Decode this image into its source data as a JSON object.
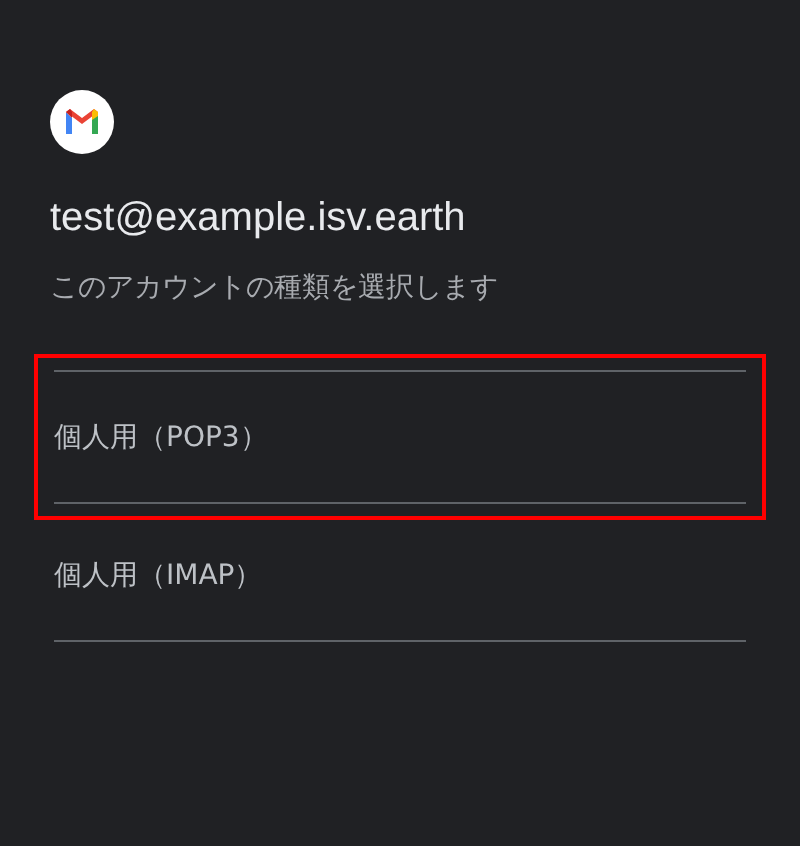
{
  "account": {
    "email": "test@example.isv.earth",
    "subtitle": "このアカウントの種類を選択します"
  },
  "options": [
    {
      "label": "個人用（POP3）",
      "highlighted": true
    },
    {
      "label": "個人用（IMAP）",
      "highlighted": false
    }
  ]
}
